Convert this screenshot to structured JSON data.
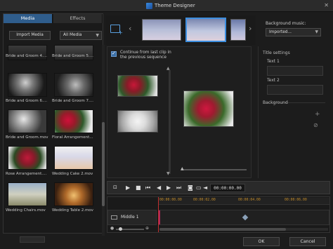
{
  "window": {
    "title": "Theme Designer",
    "close_icon": "close-icon"
  },
  "left_panel": {
    "tabs": [
      {
        "label": "Media"
      },
      {
        "label": "Effects"
      }
    ],
    "import_label": "Import Media",
    "filter_value": "All Media",
    "items": [
      {
        "label": "Bride and Groom 4...."
      },
      {
        "label": "Bride and Groom 5...."
      },
      {
        "label": "Bride and Groom 6...."
      },
      {
        "label": "Bride and Groom 7...."
      },
      {
        "label": "Bride and Groom.mov"
      },
      {
        "label": "Floral Arrangement..."
      },
      {
        "label": "Rose Arrangement...."
      },
      {
        "label": "Wedding Cake 2.mov"
      },
      {
        "label": "Wedding Chairs.mov"
      },
      {
        "label": "Wedding Table 2.mov"
      }
    ]
  },
  "background_music": {
    "label": "Background music:",
    "value": "Imported..."
  },
  "preview": {
    "continue_label": "Continue from last clip in the previous sequence",
    "continue_checked": true
  },
  "title_settings": {
    "header": "Title settings",
    "text1_label": "Text 1",
    "text2_label": "Text 2",
    "background_label": "Background"
  },
  "transport": {
    "timecode": "00:00:00.00"
  },
  "timeline": {
    "ruler_ticks": [
      "00:00:00.00",
      "00:00:02.00",
      "00:00:04.00",
      "00:00:06.00"
    ],
    "track_name": "Middle 1"
  },
  "buttons": {
    "ok": "OK",
    "cancel": "Cancel"
  }
}
